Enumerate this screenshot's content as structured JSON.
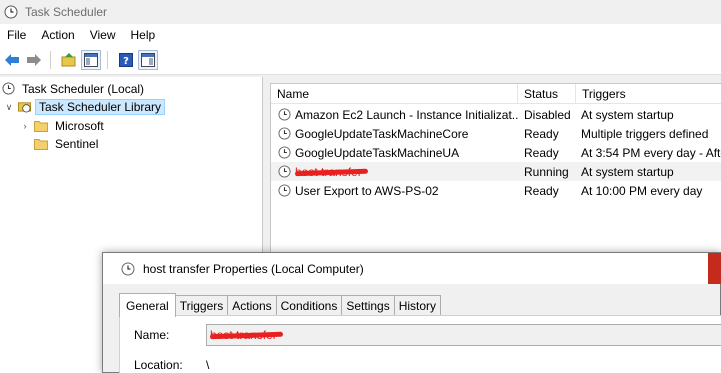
{
  "window": {
    "title": "Task Scheduler"
  },
  "menu": {
    "items": [
      "File",
      "Action",
      "View",
      "Help"
    ]
  },
  "toolbar": {
    "buttons": [
      "back-icon",
      "forward-icon",
      "up-folder-icon",
      "show-hide-console-tree-icon",
      "help-icon",
      "show-hide-action-pane-icon"
    ]
  },
  "tree": {
    "root": "Task Scheduler (Local)",
    "library": "Task Scheduler Library",
    "children": [
      "Microsoft",
      "Sentinel"
    ]
  },
  "tasks": {
    "headers": {
      "name": "Name",
      "status": "Status",
      "triggers": "Triggers"
    },
    "rows": [
      {
        "name": "Amazon Ec2 Launch - Instance Initializat...",
        "status": "Disabled",
        "triggers": "At system startup"
      },
      {
        "name": "GoogleUpdateTaskMachineCore",
        "status": "Ready",
        "triggers": "Multiple triggers defined"
      },
      {
        "name": "GoogleUpdateTaskMachineUA",
        "status": "Ready",
        "triggers": "At 3:54 PM every day - Afte"
      },
      {
        "name": "host transfer",
        "status": "Running",
        "triggers": "At system startup",
        "redacted": true
      },
      {
        "name": "User Export to AWS-PS-02",
        "status": "Ready",
        "triggers": "At 10:00 PM every day"
      }
    ]
  },
  "dialog": {
    "title": "host transfer Properties (Local Computer)",
    "tabs": [
      "General",
      "Triggers",
      "Actions",
      "Conditions",
      "Settings",
      "History"
    ],
    "active_tab": "General",
    "name_label": "Name:",
    "name_value": "host transfer",
    "location_label": "Location:",
    "location_value": "\\"
  },
  "colors": {
    "selection": "#cce8ff",
    "redaction": "#e82020",
    "close_button": "#c42b1c"
  }
}
